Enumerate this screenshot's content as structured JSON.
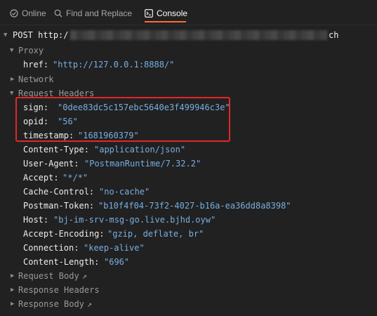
{
  "tabs": [
    {
      "label": "Online",
      "icon": "check-circle-icon"
    },
    {
      "label": "Find and Replace",
      "icon": "search-icon"
    },
    {
      "label": "Console",
      "icon": "console-icon",
      "active": true
    }
  ],
  "request": {
    "method": "POST",
    "url_start": "http:/",
    "url_end": "ch"
  },
  "proxy": {
    "label": "Proxy",
    "href_key": "href:",
    "href_value": "\"http://127.0.0.1:8888/\""
  },
  "network_label": "Network",
  "request_headers_label": "Request Headers",
  "headers": [
    {
      "key": "sign:",
      "value": "\"0dee83dc5c157ebc5640e3f499946c3e\""
    },
    {
      "key": "opid:",
      "value": "\"56\""
    },
    {
      "key": "timestamp:",
      "value": "\"1681960379\""
    },
    {
      "key": "Content-Type:",
      "value": "\"application/json\""
    },
    {
      "key": "User-Agent:",
      "value": "\"PostmanRuntime/7.32.2\""
    },
    {
      "key": "Accept:",
      "value": "\"*/*\""
    },
    {
      "key": "Cache-Control:",
      "value": "\"no-cache\""
    },
    {
      "key": "Postman-Token:",
      "value": "\"b10f4f04-73f2-4027-b16a-ea36dd8a8398\""
    },
    {
      "key": "Host:",
      "value": "\"bj-im-srv-msg-go.live.bjhd.oyw\""
    },
    {
      "key": "Accept-Encoding:",
      "value": "\"gzip, deflate, br\""
    },
    {
      "key": "Connection:",
      "value": "\"keep-alive\""
    },
    {
      "key": "Content-Length:",
      "value": "\"696\""
    }
  ],
  "request_body_label": "Request Body",
  "response_headers_label": "Response Headers",
  "response_body_label": "Response Body",
  "colors": {
    "accent": "#ff6c37",
    "highlight": "#e5252b",
    "string": "#78aee0"
  }
}
